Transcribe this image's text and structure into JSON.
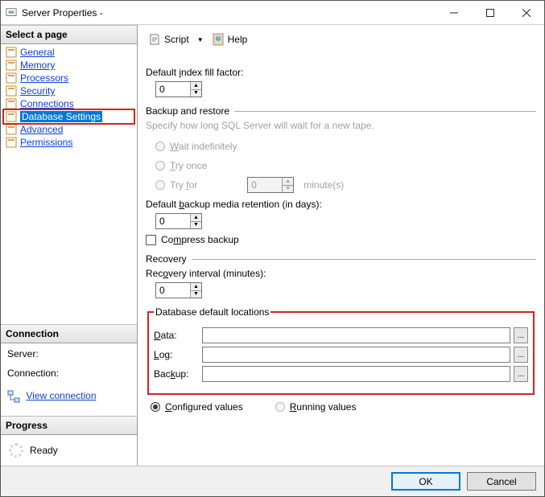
{
  "window": {
    "title": "Server Properties -"
  },
  "sidebar": {
    "select_page_header": "Select a page",
    "items": [
      {
        "label": "General"
      },
      {
        "label": "Memory"
      },
      {
        "label": "Processors"
      },
      {
        "label": "Security"
      },
      {
        "label": "Connections"
      },
      {
        "label": "Database Settings"
      },
      {
        "label": "Advanced"
      },
      {
        "label": "Permissions"
      }
    ],
    "connection": {
      "header": "Connection",
      "server_label": "Server:",
      "connection_label": "Connection:",
      "view_connection": "View connection "
    },
    "progress": {
      "header": "Progress",
      "status": "Ready"
    }
  },
  "toolbar": {
    "script_label": "Script",
    "help_label": "Help"
  },
  "form": {
    "fill_factor_label": "Default index fill factor:",
    "fill_factor_value": "0",
    "backup_restore_header": "Backup and restore",
    "backup_hint": "Specify how long SQL Server will wait for a new tape.",
    "wait_indef": "Wait indefinitely",
    "try_once": "Try once",
    "try_for": "Try for",
    "try_for_value": "0",
    "try_for_unit": "minute(s)",
    "media_retention_label": "Default backup media retention (in days):",
    "media_retention_value": "0",
    "compress_label": "Compress backup",
    "recovery_header": "Recovery",
    "recovery_interval_label": "Recovery interval (minutes):",
    "recovery_interval_value": "0",
    "locations_header": "Database default locations",
    "data_label": "Data:",
    "log_label": "Log:",
    "backup_label": "Backup:",
    "data_value": "",
    "log_value": "",
    "backup_value": "",
    "browse_glyph": "...",
    "configured_label": "Configured values",
    "running_label": "Running values"
  },
  "footer": {
    "ok": "OK",
    "cancel": "Cancel"
  }
}
